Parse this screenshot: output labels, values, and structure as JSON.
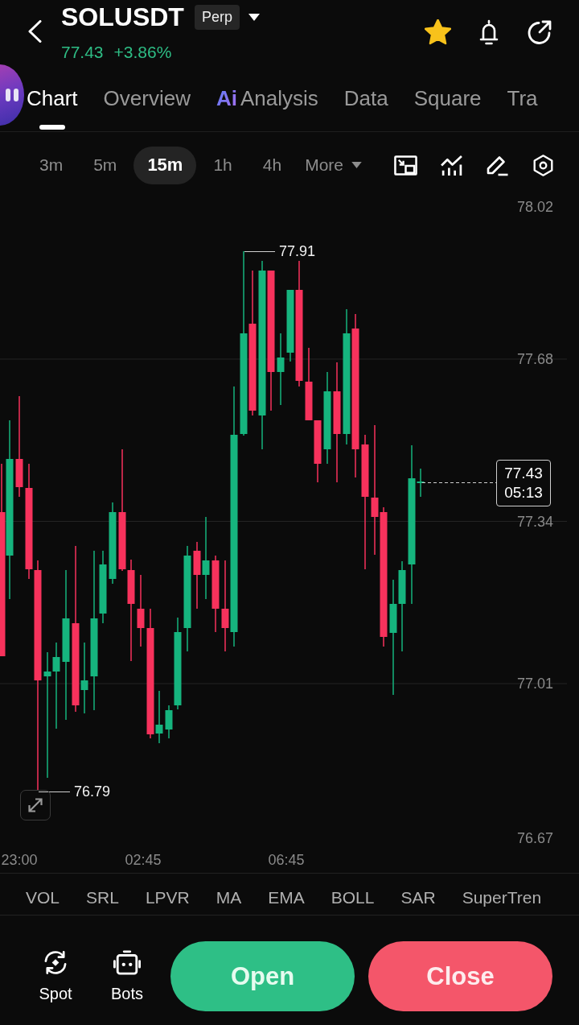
{
  "header": {
    "symbol": "SOLUSDT",
    "contract_type": "Perp",
    "last_price": "77.43",
    "change": "+3.86%",
    "favorite": true
  },
  "tabs": [
    {
      "label": "Chart",
      "selected": true
    },
    {
      "label": "Overview",
      "selected": false
    },
    {
      "prefix": "Ai",
      "label": "Analysis",
      "selected": false
    },
    {
      "label": "Data",
      "selected": false
    },
    {
      "label": "Square",
      "selected": false
    },
    {
      "label": "Tra",
      "selected": false
    }
  ],
  "intervals": [
    {
      "label": "3m",
      "selected": false
    },
    {
      "label": "5m",
      "selected": false
    },
    {
      "label": "15m",
      "selected": true
    },
    {
      "label": "1h",
      "selected": false
    },
    {
      "label": "4h",
      "selected": false
    }
  ],
  "more_menu": {
    "label": "More"
  },
  "chart": {
    "price_labels": [
      "78.02",
      "77.68",
      "77.34",
      "77.01",
      "76.67"
    ],
    "time_labels": [
      "23:00",
      "02:45",
      "06:45"
    ],
    "high_label": "77.91",
    "low_label": "76.79",
    "last_price": "77.43",
    "countdown": "05:13"
  },
  "indicators": [
    "VOL",
    "SRL",
    "LPVR",
    "MA",
    "EMA",
    "BOLL",
    "SAR",
    "SuperTren"
  ],
  "shortcuts": [
    {
      "label": "Spot",
      "kind": "spot"
    },
    {
      "label": "Bots",
      "kind": "bots"
    }
  ],
  "actions": [
    {
      "label": "Open",
      "kind": "open"
    },
    {
      "label": "Close",
      "kind": "close"
    }
  ]
}
